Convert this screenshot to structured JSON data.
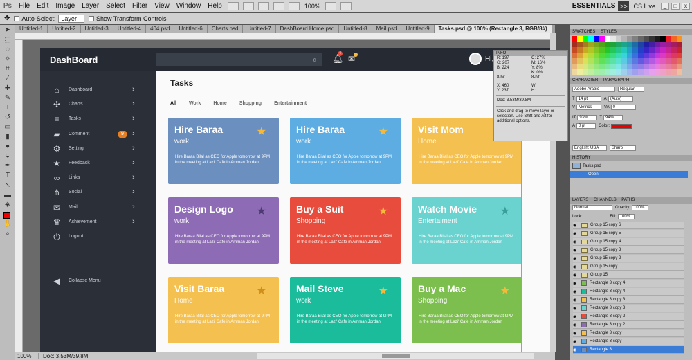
{
  "app": {
    "ps_label": "Ps",
    "menus": [
      "File",
      "Edit",
      "Image",
      "Layer",
      "Select",
      "Filter",
      "View",
      "Window",
      "Help"
    ],
    "zoom": "100%",
    "workspace": "ESSENTIALS",
    "expand_label": ">>",
    "cslive": "CS Live",
    "win_min": "_",
    "win_max": "□",
    "win_close": "x"
  },
  "options": {
    "auto_select_label": "Auto-Select:",
    "auto_select_value": "Layer",
    "show_transform": "Show Transform Controls"
  },
  "doc_tabs": [
    {
      "label": "Untitled-1"
    },
    {
      "label": "Untitled-2"
    },
    {
      "label": "Untitled-3"
    },
    {
      "label": "Untitled-4"
    },
    {
      "label": "404.psd"
    },
    {
      "label": "Untitled-6"
    },
    {
      "label": "Charts.psd"
    },
    {
      "label": "Untitled-7"
    },
    {
      "label": "DashBoard Home.psd"
    },
    {
      "label": "Untitled-8"
    },
    {
      "label": "Mail.psd"
    },
    {
      "label": "Untitled-9"
    },
    {
      "label": "Tasks.psd @ 100% (Rectangle 3, RGB/8#)"
    }
  ],
  "status": {
    "zoom": "100%",
    "doc": "Doc: 3.53M/39.8M"
  },
  "dashboard": {
    "brand": "DashBoard",
    "bell_count": "4",
    "greeting": "Hi,",
    "nav": [
      {
        "label": "Dashboard",
        "icon": "home"
      },
      {
        "label": "Charts",
        "icon": "chart"
      },
      {
        "label": "Tasks",
        "icon": "tasks"
      },
      {
        "label": "Comment",
        "icon": "comment",
        "badge": "9"
      },
      {
        "label": "Setting",
        "icon": "gear"
      },
      {
        "label": "Feedback",
        "icon": "star"
      },
      {
        "label": "Links",
        "icon": "link"
      },
      {
        "label": "Social",
        "icon": "share"
      },
      {
        "label": "Mail",
        "icon": "mail"
      },
      {
        "label": "Achievement",
        "icon": "trophy"
      },
      {
        "label": "Logout",
        "icon": "power"
      }
    ],
    "collapse_label": "Collapse Menu",
    "page_title": "Tasks",
    "filters": [
      {
        "label": "All",
        "active": true
      },
      {
        "label": "Work"
      },
      {
        "label": "Home"
      },
      {
        "label": "Shopping"
      },
      {
        "label": "Entertainment"
      }
    ],
    "cards": [
      {
        "title": "Hire Baraa",
        "subtitle": "work",
        "desc": "Hire Baraa Bilal as CEO for Apple tomorrow at 9PM in the meeting at Lazi' Cafe in Amman Jordan",
        "color": "#6b8fbf",
        "star": "#f5b93b"
      },
      {
        "title": "Hire Baraa",
        "subtitle": "work",
        "desc": "Hire Baraa Bilal as CEO for Apple tomorrow at 9PM in the meeting at Lazi' Cafe in Amman Jordan",
        "color": "#5dade2",
        "star": "#f5b93b"
      },
      {
        "title": "Visit Mom",
        "subtitle": "Home",
        "desc": "Hire Baraa Bilal as CEO for Apple tomorrow at 9PM in the meeting at Lazi' Cafe in Amman Jordan",
        "color": "#f4c04f",
        "star": "#f5a623"
      },
      {
        "title": "Design Logo",
        "subtitle": "work",
        "desc": "Hire Baraa Bilal as CEO for Apple tomorrow at 9PM in the meeting at Lazi' Cafe in Amman Jordan",
        "color": "#8e6bb5",
        "star": "#4d3a72"
      },
      {
        "title": "Buy a Suit",
        "subtitle": "Shopping",
        "desc": "Hire Baraa Bilal as CEO for Apple tomorrow at 9PM in the meeting at Lazi' Cafe in Amman Jordan",
        "color": "#e74c3c",
        "star": "#f5b93b"
      },
      {
        "title": "Watch Movie",
        "subtitle": "Entertaiment",
        "desc": "Hire Baraa Bilal as CEO for Apple tomorrow at 9PM in the meeting at Lazi' Cafe in Amman Jordan",
        "color": "#6bd3cf",
        "star": "#3a9e99"
      },
      {
        "title": "Visit Baraa",
        "subtitle": "Home",
        "desc": "Hire Baraa Bilal as CEO for Apple tomorrow at 9PM in the meeting at Lazi' Cafe in Amman Jordan",
        "color": "#f4c04f",
        "star": "#d08e1a"
      },
      {
        "title": "Mail Steve",
        "subtitle": "work",
        "desc": "Hire Baraa Bilal as CEO for Apple tomorrow at 9PM in the meeting at Lazi' Cafe in Amman Jordan",
        "color": "#1abc9c",
        "star": "#f5b93b"
      },
      {
        "title": "Buy a Mac",
        "subtitle": "Shopping",
        "desc": "Hire Baraa Bilal as CEO for Apple tomorrow at 9PM in the meeting at Lazi' Cafe in Amman Jordan",
        "color": "#7dbf4e",
        "star": "#f5b93b"
      }
    ]
  },
  "info": {
    "header": "INFO",
    "r": "R:  197",
    "g": "G:  207",
    "b": "B:  224",
    "c": "C:  27%",
    "m": "M:  16%",
    "y": "Y:  8%",
    "k": "K:  0%",
    "bit1": "8-bit",
    "bit2": "8-bit",
    "x": "X:  460",
    "yv": "Y:  237",
    "w": "W:",
    "h": "H:",
    "doc": "Doc: 3.53M/39.8M",
    "note": "Click and drag to move layer or selection.  Use Shift and Alt for additional options."
  },
  "panels": {
    "swatches_tab": "SWATCHES",
    "styles_tab": "STYLES",
    "character_tab": "CHARACTER",
    "paragraph_tab": "PARAGRAPH",
    "font": "Adobe Arabic",
    "font_style": "Regular",
    "size": "14 pt",
    "leading": "(Auto)",
    "kerning": "Metrics",
    "tracking": "0",
    "vscale": "93%",
    "hscale": "94%",
    "baseline": "0 pt",
    "color_label": "Color:",
    "language": "English: USA",
    "aa": "Sharp",
    "history_tab": "HISTORY",
    "history_file": "Tasks.psd",
    "history_open": "Open",
    "layers_tab": "LAYERS",
    "channels_tab": "CHANNELS",
    "paths_tab": "PATHS",
    "blend": "Normal",
    "opacity_label": "Opacity:",
    "opacity": "100%",
    "lock_label": "Lock:",
    "fill_label": "Fill:",
    "fill": "100%",
    "layers": [
      {
        "name": "Group 15 copy 6",
        "type": "group"
      },
      {
        "name": "Group 15 copy 5",
        "type": "group"
      },
      {
        "name": "Group 15 copy 4",
        "type": "group"
      },
      {
        "name": "Group 15 copy 3",
        "type": "group"
      },
      {
        "name": "Group 15 copy 2",
        "type": "group"
      },
      {
        "name": "Group 15 copy",
        "type": "group"
      },
      {
        "name": "Group 15",
        "type": "group"
      },
      {
        "name": "Rectangle 3 copy 4",
        "type": "rect",
        "color": "#7dbf4e"
      },
      {
        "name": "Rectangle 3 copy 4",
        "type": "rect",
        "color": "#1abc9c"
      },
      {
        "name": "Rectangle 3 copy 3",
        "type": "rect",
        "color": "#f4c04f"
      },
      {
        "name": "Rectangle 3 copy 3",
        "type": "rect",
        "color": "#6bd3cf"
      },
      {
        "name": "Rectangle 3 copy 2",
        "type": "rect",
        "color": "#e74c3c"
      },
      {
        "name": "Rectangle 3 copy 2",
        "type": "rect",
        "color": "#8e6bb5"
      },
      {
        "name": "Rectangle 3 copy",
        "type": "rect",
        "color": "#f4c04f"
      },
      {
        "name": "Rectangle 3 copy",
        "type": "rect",
        "color": "#5dade2"
      },
      {
        "name": "Rectangle 3",
        "type": "rect",
        "color": "#6b8fbf",
        "selected": true
      }
    ]
  }
}
